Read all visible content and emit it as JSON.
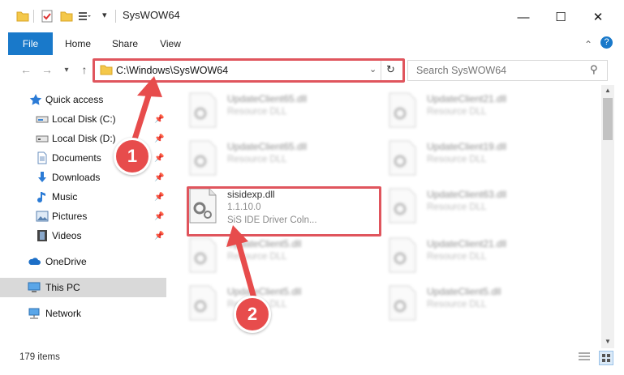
{
  "window": {
    "title": "SysWOW64",
    "minimize": "—",
    "maximize": "☐",
    "close": "✕"
  },
  "ribbon": {
    "tabs": [
      "File",
      "Home",
      "Share",
      "View"
    ],
    "help": "?"
  },
  "address": {
    "path": "C:\\Windows\\SysWOW64",
    "search_placeholder": "Search SysWOW64"
  },
  "nav": {
    "quick_access": "Quick access",
    "items": [
      "Local Disk (C:)",
      "Local Disk (D:)",
      "Documents",
      "Downloads",
      "Music",
      "Pictures",
      "Videos"
    ],
    "onedrive": "OneDrive",
    "this_pc": "This PC",
    "network": "Network"
  },
  "files": [
    {
      "name": "UpdateClient65.dll",
      "line2": "Resource DLL",
      "line3": ""
    },
    {
      "name": "UpdateClient21.dll",
      "line2": "Resource DLL",
      "line3": ""
    },
    {
      "name": "UpdateClient65.dll",
      "line2": "Resource DLL",
      "line3": ""
    },
    {
      "name": "UpdateClient19.dll",
      "line2": "Resource DLL",
      "line3": ""
    },
    {
      "name": "sisidexp.dll",
      "line2": "1.1.10.0",
      "line3": "SiS IDE Driver Coln..."
    },
    {
      "name": "UpdateClient63.dll",
      "line2": "Resource DLL",
      "line3": ""
    },
    {
      "name": "UpdateClient5.dll",
      "line2": "Resource DLL",
      "line3": ""
    },
    {
      "name": "UpdateClient21.dll",
      "line2": "Resource DLL",
      "line3": ""
    },
    {
      "name": "UpdateClient5.dll",
      "line2": "Resource DLL",
      "line3": ""
    },
    {
      "name": "UpdateClient5.dll",
      "line2": "Resource DLL",
      "line3": ""
    }
  ],
  "status": {
    "count": "179 items"
  },
  "annotations": {
    "one": "1",
    "two": "2"
  },
  "colors": {
    "accent": "#1979ca",
    "highlight": "#e0555d",
    "badge": "#e74c4c"
  }
}
